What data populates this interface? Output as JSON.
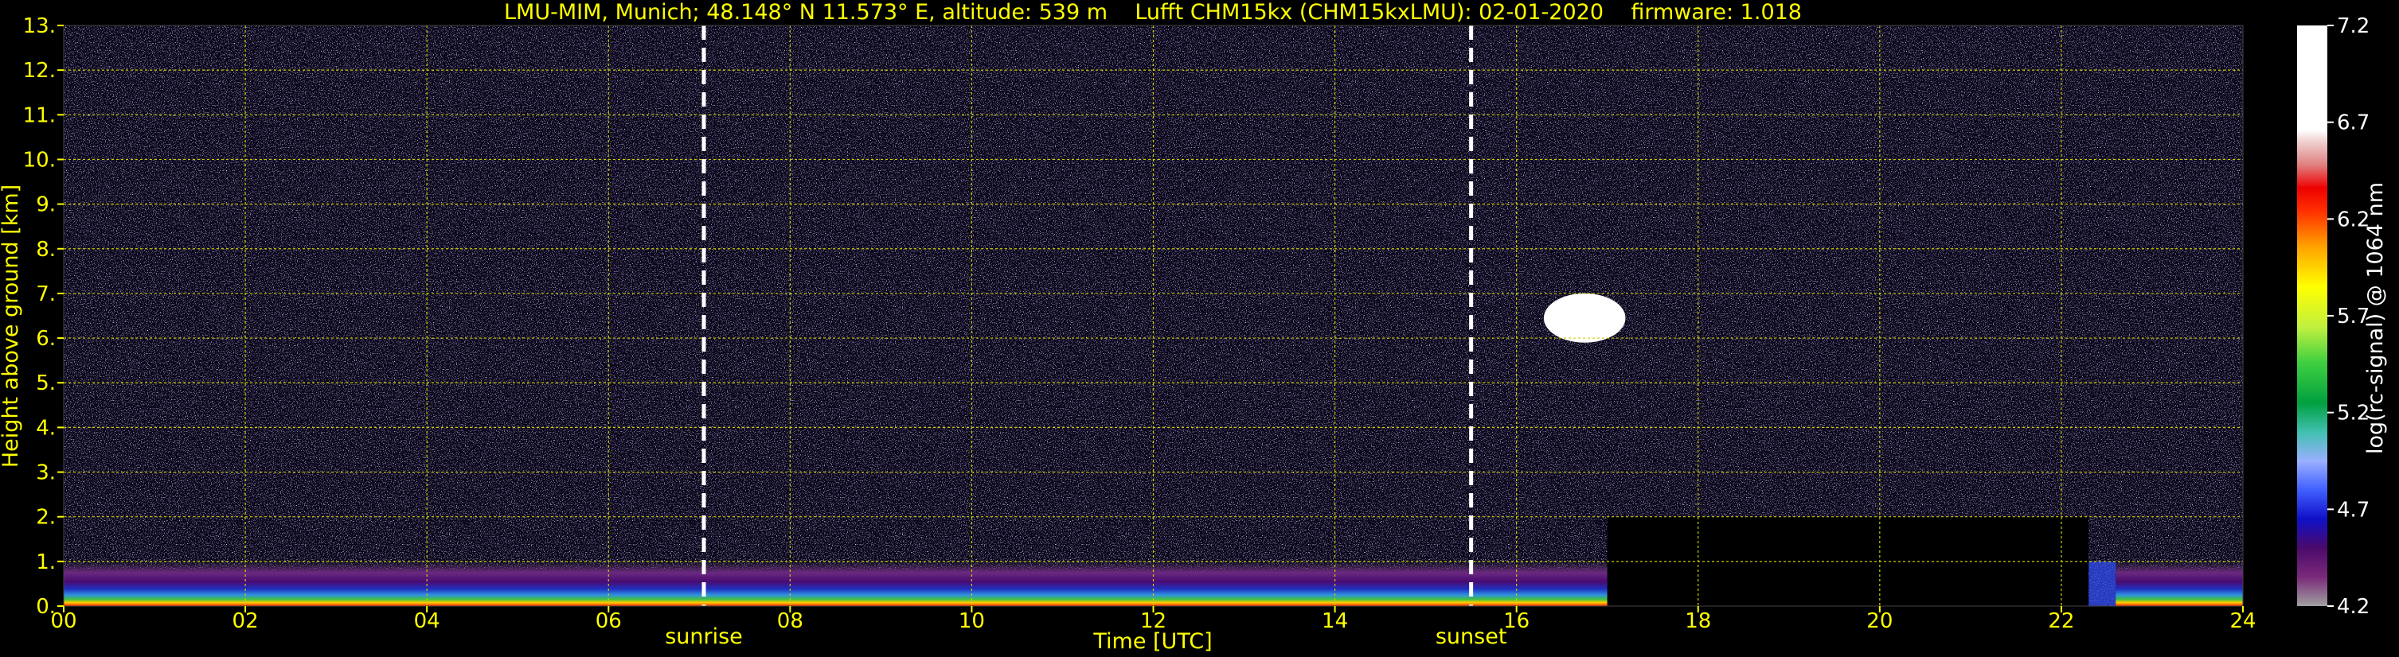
{
  "chart_data": {
    "type": "heatmap",
    "title": "LMU-MIM, Munich; 48.148° N 11.573° E, altitude: 539 m    Lufft CHM15kx (CHM15kxLMU): 02-01-2020    firmware: 1.018",
    "xlabel": "Time [UTC]",
    "ylabel": "Height above ground [km]",
    "xlim": [
      0,
      24
    ],
    "ylim": [
      0,
      13
    ],
    "x_ticks": [
      "00",
      "02",
      "04",
      "06",
      "08",
      "10",
      "12",
      "14",
      "16",
      "18",
      "20",
      "22",
      "24"
    ],
    "y_ticks": [
      "0.",
      "1.",
      "2.",
      "3.",
      "4.",
      "5.",
      "6.",
      "7.",
      "8.",
      "9.",
      "10.",
      "11.",
      "12.",
      "13."
    ],
    "grid": true,
    "annotations": [
      {
        "label": "sunrise",
        "time_utc": 7.05
      },
      {
        "label": "sunset",
        "time_utc": 15.5
      }
    ],
    "colorbar": {
      "label": "log(rc-signal) @ 1064 nm",
      "range": [
        4.2,
        7.2
      ],
      "ticks": [
        "4.2",
        "4.7",
        "5.2",
        "5.7",
        "6.2",
        "6.7",
        "7.2"
      ]
    },
    "features": [
      {
        "name": "boundary layer aerosol",
        "x_range": [
          0,
          17.0
        ],
        "height_km": [
          0,
          1.0
        ]
      },
      {
        "name": "cloud",
        "x_range": [
          16.3,
          17.2
        ],
        "height_km": [
          5.9,
          7.0
        ]
      },
      {
        "name": "low cloud",
        "x_range": [
          22.3,
          22.6
        ],
        "height_km": [
          0,
          1.0
        ]
      }
    ]
  },
  "colors": {
    "text": "#ffff00",
    "grid": "#cccc00",
    "cb_text": "#ffffff",
    "terminator": "#ffffff"
  }
}
